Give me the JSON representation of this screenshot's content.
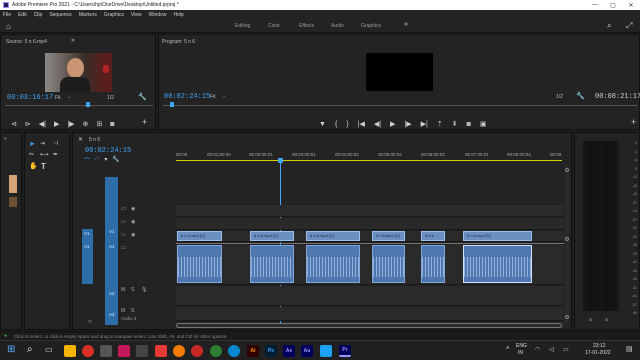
{
  "window": {
    "title": "Adobe Premiere Pro 2021 - C:\\Users\\hp\\OneDrive\\Desktop\\Untitled.prproj *",
    "controls": {
      "minimize": "—",
      "maximize": "▢",
      "close": "✕"
    }
  },
  "menu": [
    "File",
    "Edit",
    "Clip",
    "Sequence",
    "Markers",
    "Graphics",
    "View",
    "Window",
    "Help"
  ],
  "workspaces": [
    "Editing",
    "Color",
    "Effects",
    "Audio",
    "Graphics"
  ],
  "workspaces_more": "»",
  "source": {
    "tab": "Source: 5 n 6.mp4",
    "timecode": "00:03:16:17",
    "fit": "Fit",
    "resolution": "1/2"
  },
  "program": {
    "tab": "Program: 5 n 6",
    "timecode": "00:02:24:15",
    "fit": "Fit",
    "resolution": "1/2",
    "duration": "00:08:21:17"
  },
  "timeline": {
    "tab": "5 n 6",
    "timecode": "00:02:24:15",
    "ruler": [
      "00:00",
      "00:01:00:00",
      "00:02:00:01",
      "00:03:00:01",
      "00:04:00:02",
      "00:05:00:02",
      "00:06:00:03",
      "00:07:00:01",
      "00:08:00:04",
      "00:09"
    ],
    "video_tracks": [
      "V3",
      "V2",
      "V1"
    ],
    "audio_tracks": [
      "A1",
      "A2",
      "A3"
    ],
    "source_patch": [
      "V1",
      "A1"
    ],
    "audio_track_name": "Audio 3",
    "clip_label": "5 n 6.mp4 [V]",
    "short_clip_label": "5 n 6",
    "track_buttons": {
      "mute": "M",
      "solo": "S"
    }
  },
  "status_bar": "Click to select, or click in empty space and drag to marquee select. Use Shift, Alt, and Ctrl for other options.",
  "meter": {
    "scale": [
      "0",
      "-3",
      "-6",
      "-9",
      "-12",
      "-15",
      "-18",
      "-21",
      "-24",
      "-27",
      "-30",
      "-33",
      "-36",
      "-39",
      "-42",
      "-45",
      "-48",
      "-51",
      "-54",
      "-57",
      "dB"
    ],
    "channels": [
      "S",
      "S"
    ]
  },
  "taskbar": {
    "apps": [
      "Ai",
      "Ps",
      "Ae",
      "Au",
      "Pr"
    ],
    "lang_top": "ENG",
    "lang_bottom": "IN",
    "time": "23:12",
    "date": "17-01-2022"
  },
  "colors": {
    "accent": "#3fa7ff",
    "clip_video": "#6a8fc0",
    "clip_audio": "#4f78b0",
    "playhead": "#3fa7ff",
    "work_area": "#d8d000"
  }
}
